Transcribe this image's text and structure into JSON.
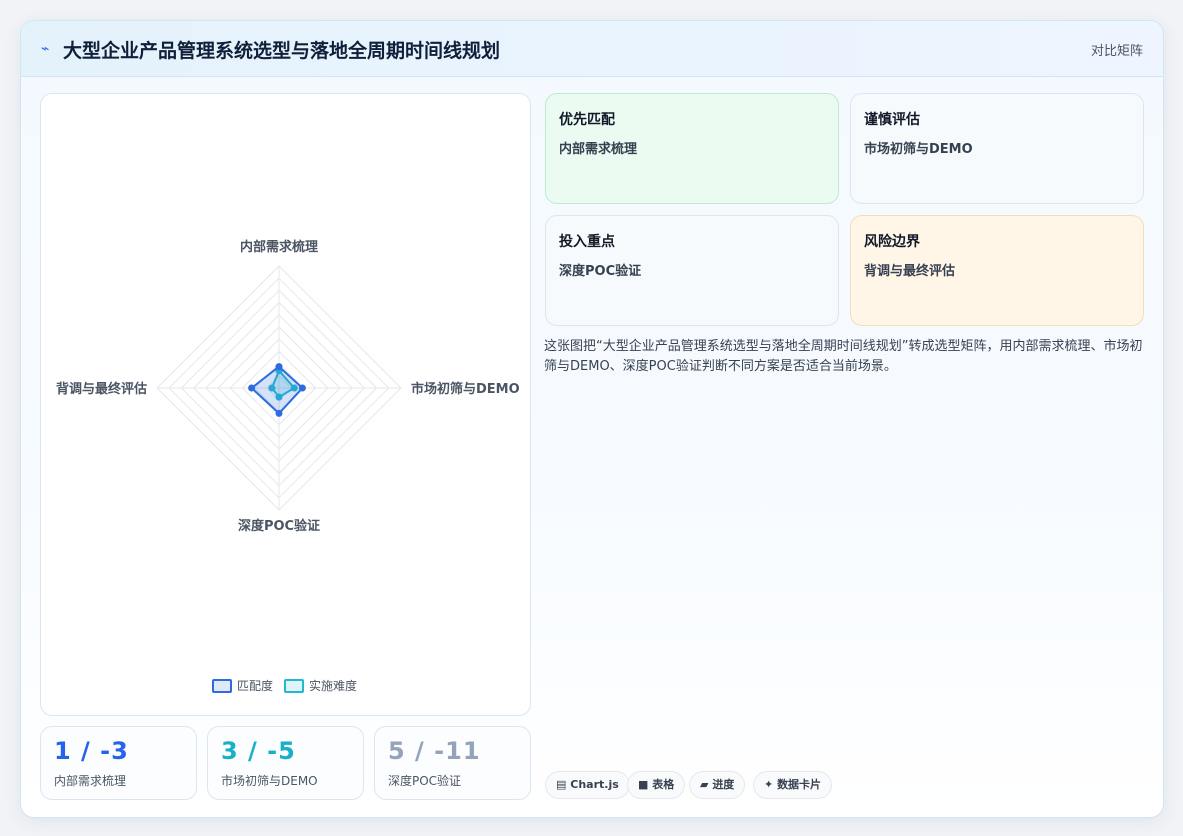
{
  "header": {
    "icon": "sparkline-icon",
    "title": "大型企业产品管理系统选型与落地全周期时间线规划",
    "right_label": "对比矩阵"
  },
  "chart_data": {
    "type": "radar",
    "axes": [
      "内部需求梳理",
      "市场初筛与DEMO",
      "深度POC验证",
      "背调与最终评估"
    ],
    "series": [
      {
        "name": "匹配度",
        "values": [
          1,
          3,
          5,
          7
        ],
        "color": "#2d6cdf"
      },
      {
        "name": "实施难度",
        "values": [
          -3,
          -5,
          -11,
          -13
        ],
        "color": "#22b8cf"
      }
    ],
    "legend_position": "bottom"
  },
  "stats": [
    {
      "value": "1 / -3",
      "label": "内部需求梳理",
      "color": "#2563eb"
    },
    {
      "value": "3 / -5",
      "label": "市场初筛与DEMO",
      "color": "#17b0c7"
    },
    {
      "value": "5 / -11",
      "label": "深度POC验证",
      "color": "#94a3b8"
    }
  ],
  "quadrants": [
    {
      "title": "优先匹配",
      "subtitle": "内部需求梳理"
    },
    {
      "title": "谨慎评估",
      "subtitle": "市场初筛与DEMO"
    },
    {
      "title": "投入重点",
      "subtitle": "深度POC验证"
    },
    {
      "title": "风险边界",
      "subtitle": "背调与最终评估"
    }
  ],
  "description": "这张图把“大型企业产品管理系统选型与落地全周期时间线规划”转成选型矩阵，用内部需求梳理、市场初筛与DEMO、深度POC验证判断不同方案是否适合当前场景。",
  "tags": [
    {
      "icon": "▤",
      "label": "Chart.js"
    },
    {
      "icon": "■",
      "label": "表格"
    },
    {
      "icon": "▰",
      "label": "进度"
    },
    {
      "icon": "✦",
      "label": "数据卡片"
    }
  ],
  "colors": {
    "accent": "#2d6cdf",
    "secondary": "#22b8cf",
    "green_card": "#ebfbf2",
    "orange_card": "#fff6e8"
  }
}
